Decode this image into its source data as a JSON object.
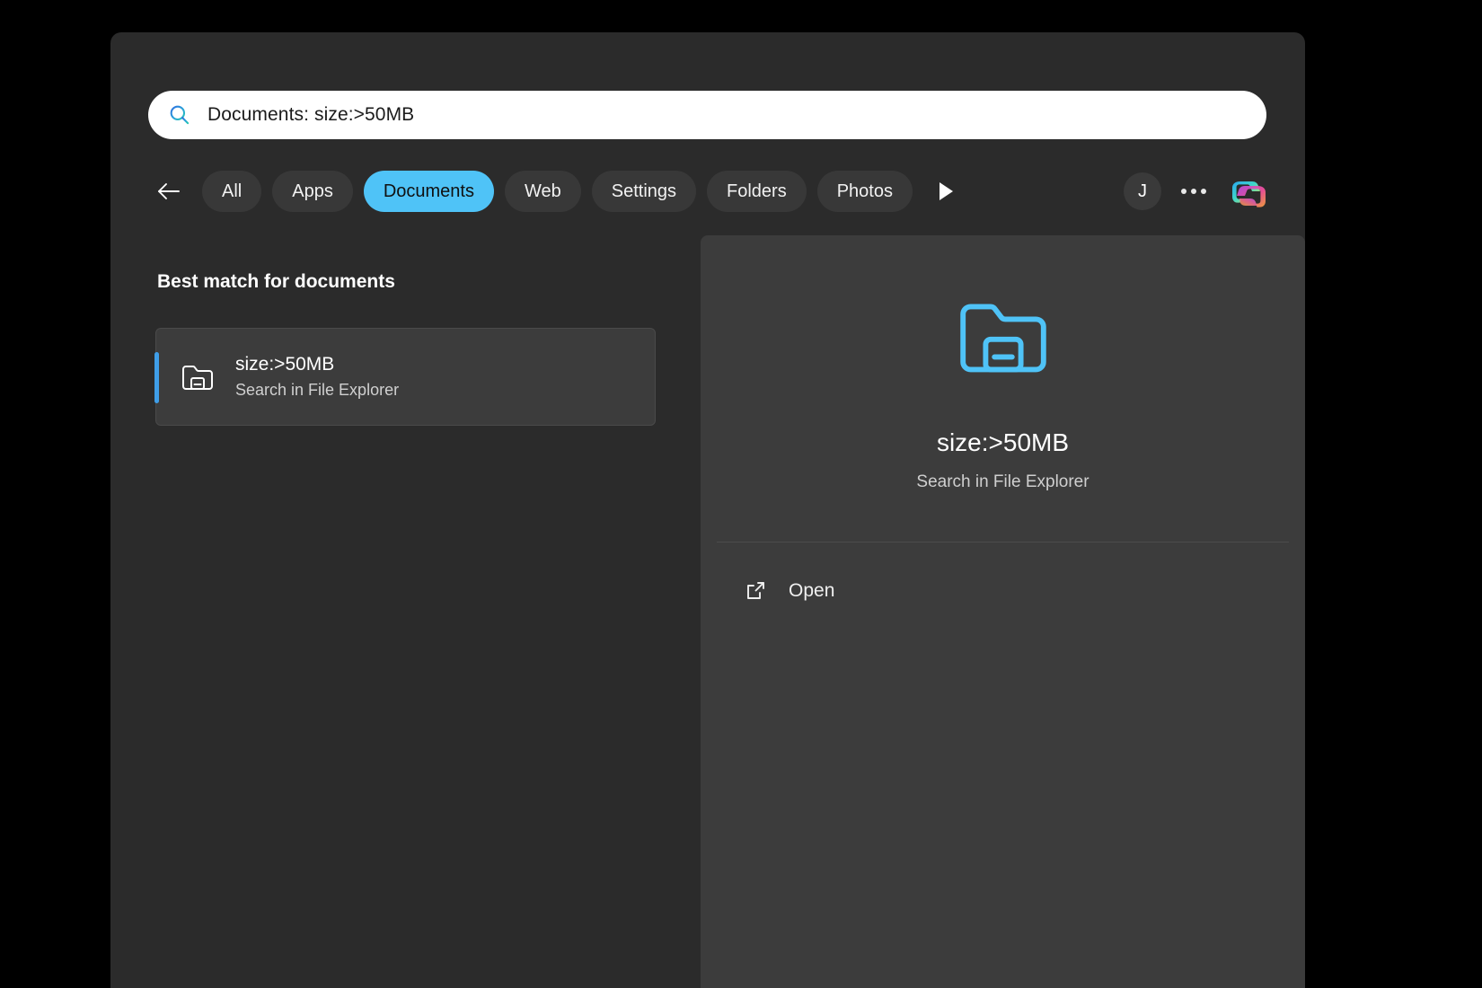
{
  "search": {
    "value": "Documents: size:>50MB",
    "icon": "search-icon"
  },
  "tabbar": {
    "back_icon": "arrow-left-icon",
    "more_icon": "chevron-right-triangle-icon",
    "chips": [
      {
        "label": "All",
        "active": false
      },
      {
        "label": "Apps",
        "active": false
      },
      {
        "label": "Documents",
        "active": true
      },
      {
        "label": "Web",
        "active": false
      },
      {
        "label": "Settings",
        "active": false
      },
      {
        "label": "Folders",
        "active": false
      },
      {
        "label": "Photos",
        "active": false
      }
    ],
    "avatar_initial": "J",
    "overflow_icon": "ellipsis-icon",
    "copilot_icon": "copilot-icon"
  },
  "results": {
    "heading": "Best match for documents",
    "item": {
      "title": "size:>50MB",
      "subtitle": "Search in File Explorer",
      "icon": "folder-search-icon"
    }
  },
  "preview": {
    "icon": "folder-search-icon",
    "title": "size:>50MB",
    "subtitle": "Search in File Explorer",
    "actions": [
      {
        "label": "Open",
        "icon": "open-external-icon"
      }
    ]
  },
  "colors": {
    "accent_blue": "#4fc3f7",
    "selection_bar": "#3f9ee8",
    "window_bg": "#2b2b2b",
    "panel_bg": "#3c3c3c",
    "page_bg": "#000000"
  }
}
